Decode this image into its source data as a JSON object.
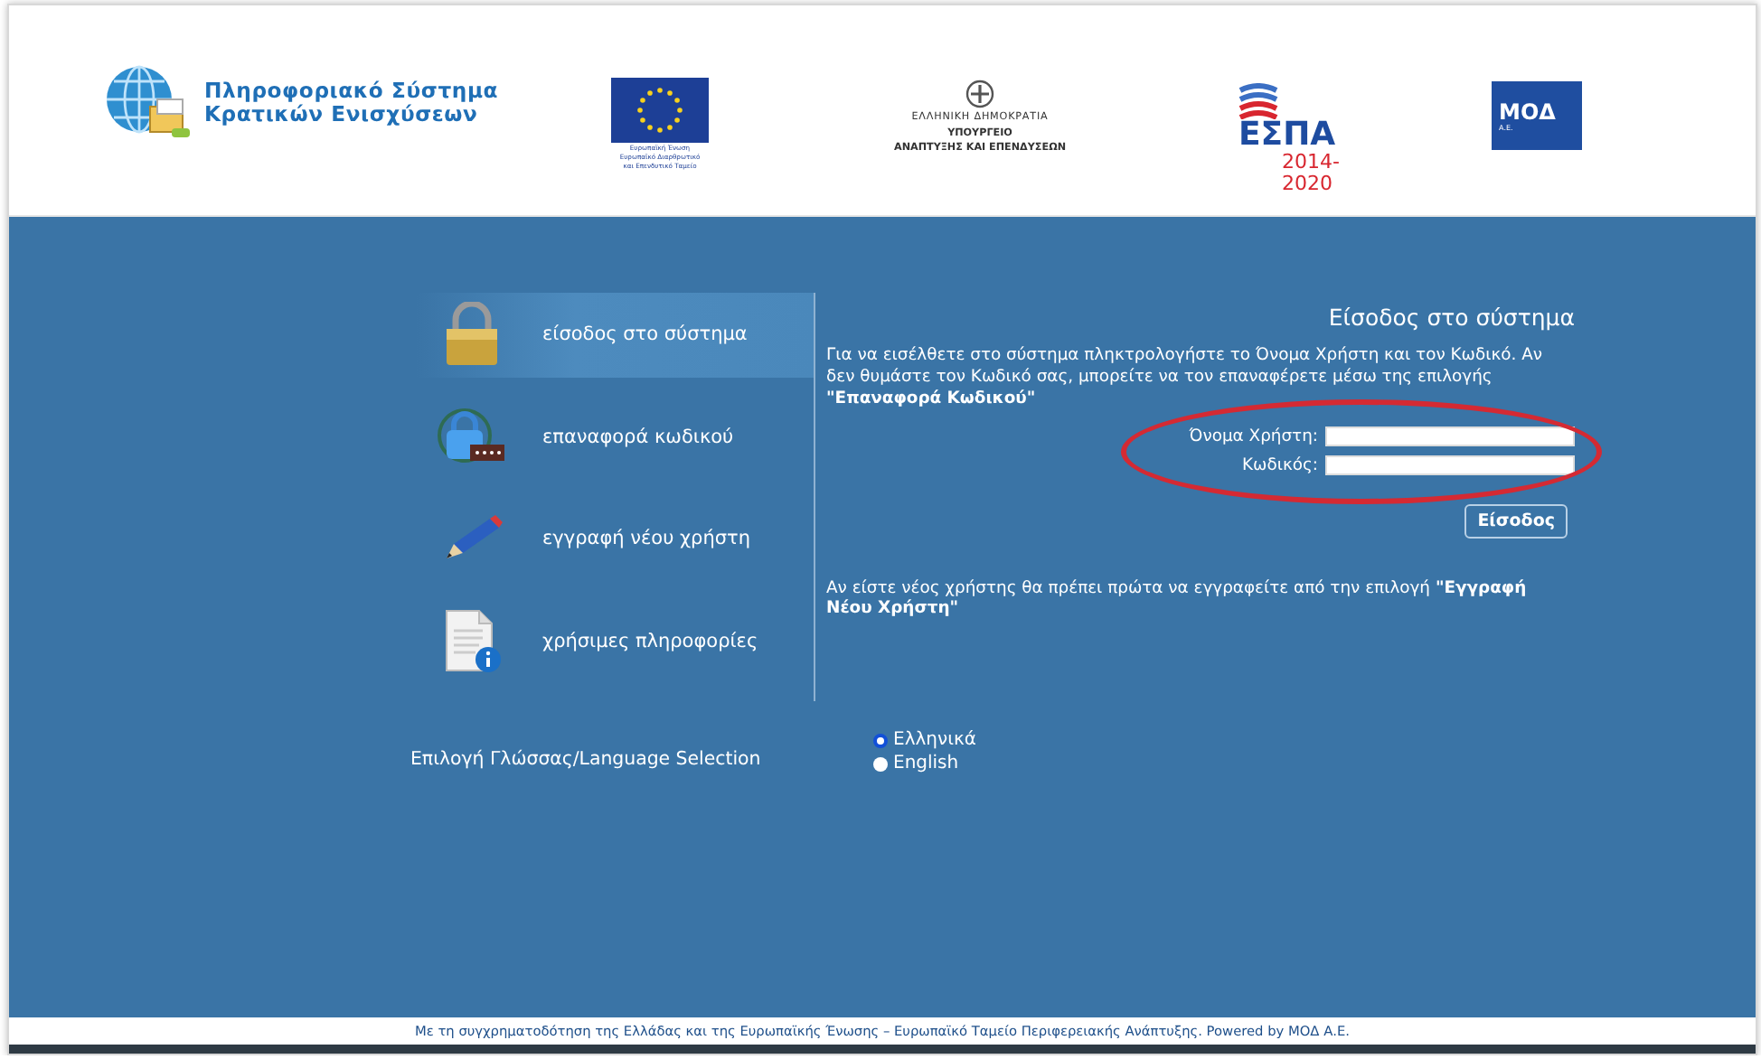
{
  "header": {
    "logos": [
      {
        "kind": "system",
        "lines": [
          "Πληροφοριακό Σύστημα",
          "Κρατικών Ενισχύσεων"
        ]
      },
      {
        "kind": "eu",
        "lines": [
          "Ευρωπαϊκή Ένωση",
          "Ευρωπαϊκό Διαρθρωτικό",
          "και Επενδυτικό Ταμείο"
        ]
      },
      {
        "kind": "ministry",
        "lines": [
          "ΕΛΛΗΝΙΚΗ ΔΗΜΟΚΡΑΤΙΑ",
          "ΥΠΟΥΡΓΕΙΟ",
          "ΑΝΑΠΤΥΞΗΣ ΚΑΙ ΕΠΕΝΔΥΣΕΩΝ"
        ]
      },
      {
        "kind": "espa",
        "lines": [
          "ΕΣΠΑ",
          "2014-2020"
        ]
      },
      {
        "kind": "mod",
        "lines": [
          "ΜΟΔ",
          "Α.Ε."
        ]
      }
    ]
  },
  "menu": [
    {
      "kind": "lock",
      "label": "είσοδος στο σύστημα",
      "selected": true
    },
    {
      "kind": "reset",
      "label": "επαναφορά κωδικού",
      "selected": false
    },
    {
      "kind": "pencil",
      "label": "εγγραφή νέου χρήστη",
      "selected": false
    },
    {
      "kind": "document",
      "label": "χρήσιμες πληροφορίες",
      "selected": false
    }
  ],
  "login": {
    "title": "Είσοδος στο σύστημα",
    "intro": "Για να εισέλθετε στο σύστημα πληκτρολογήστε το Όνομα Χρήστη και τον Κωδικό. Αν δεν θυμάστε τον Κωδικό σας, μπορείτε να τον επαναφέρετε μέσω της επιλογής **\"Επαναφορά Κωδικού\"**",
    "fields": [
      {
        "label": "Όνομα Χρήστη:"
      },
      {
        "label": "Κωδικός:"
      }
    ],
    "highlighted": true,
    "button": "Είσοδος",
    "note": "Αν είστε νέος χρήστης θα πρέπει πρώτα να εγγραφείτε από την επιλογή **\"Εγγραφή Νέου Χρήστη\"**"
  },
  "language": {
    "label": "Επιλογή Γλώσσας/Language Selection",
    "options": [
      {
        "label": "Ελληνικά",
        "selected": true
      },
      {
        "label": "English",
        "selected": false
      }
    ]
  },
  "footer": "Με τη συγχρηματοδότηση της Ελλάδας και της Ευρωπαϊκής Ένωσης – Ευρωπαϊκό Ταμείο Περιφερειακής Ανάπτυξης. Powered by ΜΟΔ Α.Ε."
}
